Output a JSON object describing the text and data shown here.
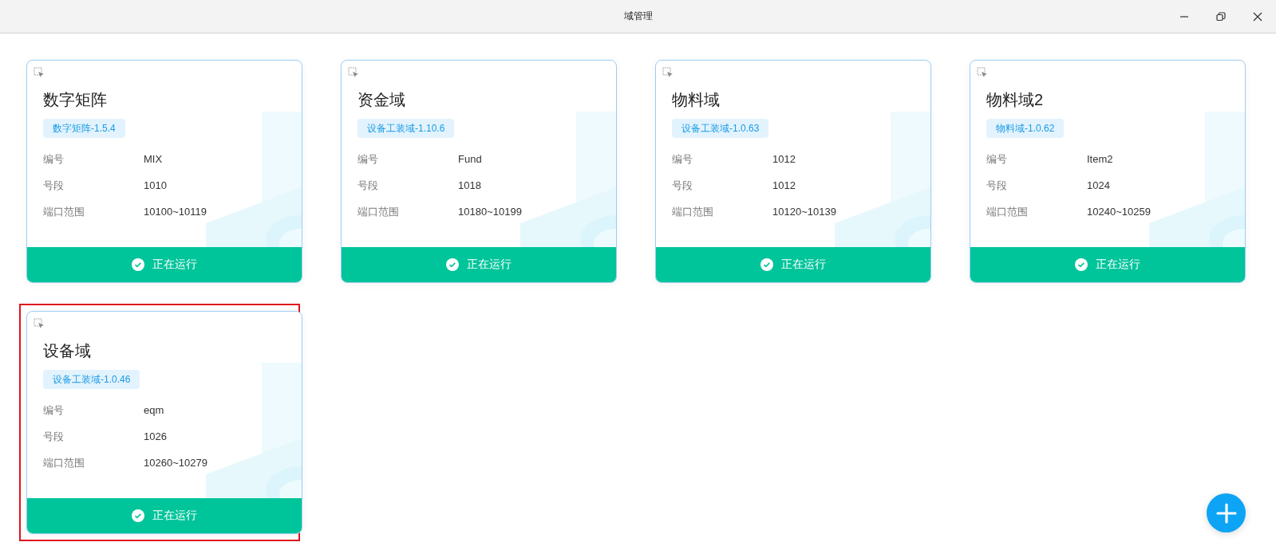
{
  "window": {
    "title": "域管理"
  },
  "cards": [
    {
      "title": "数字矩阵",
      "tag": "数字矩阵-1.5.4",
      "selected": false,
      "fields": [
        {
          "label": "编号",
          "value": "MIX"
        },
        {
          "label": "号段",
          "value": "1010"
        },
        {
          "label": "端口范围",
          "value": "10100~10119"
        }
      ],
      "status": {
        "text": "正在运行",
        "running": true
      }
    },
    {
      "title": "资金域",
      "tag": "设备工装域-1.10.6",
      "selected": false,
      "fields": [
        {
          "label": "编号",
          "value": "Fund"
        },
        {
          "label": "号段",
          "value": "1018"
        },
        {
          "label": "端口范围",
          "value": "10180~10199"
        }
      ],
      "status": {
        "text": "正在运行",
        "running": true
      }
    },
    {
      "title": "物料域",
      "tag": "设备工装域-1.0.63",
      "selected": false,
      "fields": [
        {
          "label": "编号",
          "value": "1012"
        },
        {
          "label": "号段",
          "value": "1012"
        },
        {
          "label": "端口范围",
          "value": "10120~10139"
        }
      ],
      "status": {
        "text": "正在运行",
        "running": true
      }
    },
    {
      "title": "物料域2",
      "tag": "物料域-1.0.62",
      "selected": false,
      "fields": [
        {
          "label": "编号",
          "value": "Item2"
        },
        {
          "label": "号段",
          "value": "1024"
        },
        {
          "label": "端口范围",
          "value": "10240~10259"
        }
      ],
      "status": {
        "text": "正在运行",
        "running": true
      }
    },
    {
      "title": "设备域",
      "tag": "设备工装域-1.0.46",
      "selected": true,
      "fields": [
        {
          "label": "编号",
          "value": "eqm"
        },
        {
          "label": "号段",
          "value": "1026"
        },
        {
          "label": "端口范围",
          "value": "10260~10279"
        }
      ],
      "status": {
        "text": "正在运行",
        "running": true
      }
    }
  ]
}
